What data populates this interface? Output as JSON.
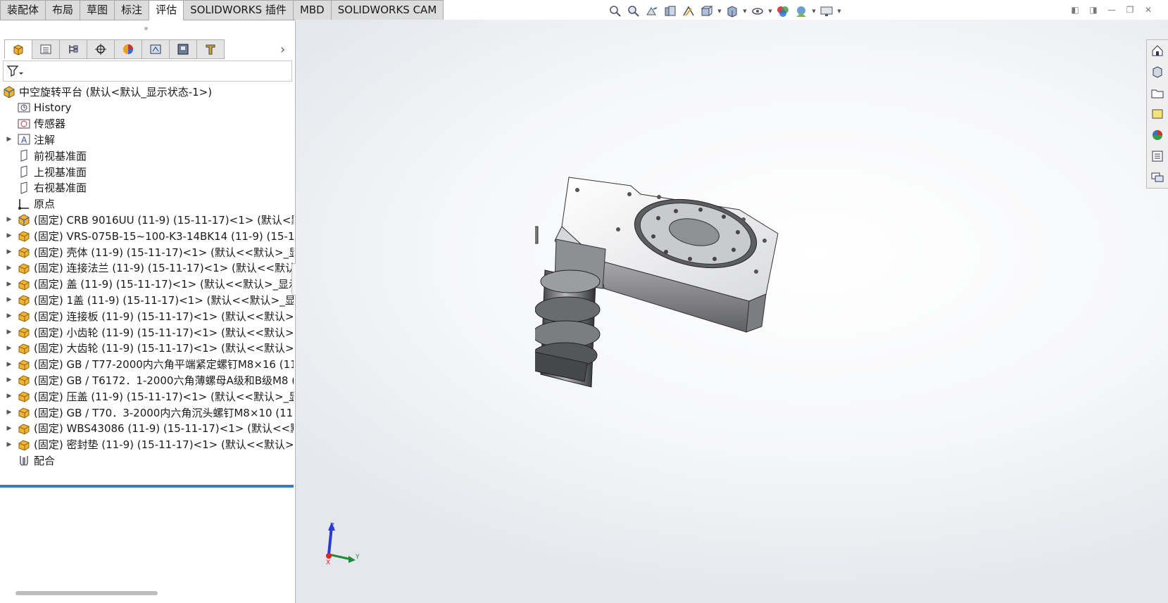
{
  "command_tabs": [
    {
      "label": "装配体"
    },
    {
      "label": "布局"
    },
    {
      "label": "草图"
    },
    {
      "label": "标注"
    },
    {
      "label": "评估",
      "active": true
    },
    {
      "label": "SOLIDWORKS 插件"
    },
    {
      "label": "MBD"
    },
    {
      "label": "SOLIDWORKS CAM"
    }
  ],
  "heads_up_toolbar": {
    "icons": [
      "zoom-to-fit-icon",
      "zoom-to-area-icon",
      "previous-view-icon",
      "section-view-icon",
      "dynamic-annotation-icon",
      "view-orientation-icon",
      "display-style-icon",
      "hide-show-items-icon",
      "edit-appearance-icon",
      "apply-scene-icon",
      "view-settings-icon"
    ]
  },
  "feature_tree": {
    "root": "中空旋转平台 (默认<默认_显示状态-1>)",
    "items": [
      {
        "label": "History",
        "icon": "history-folder-icon",
        "expandable": false
      },
      {
        "label": "传感器",
        "icon": "sensors-folder-icon",
        "expandable": false
      },
      {
        "label": "注解",
        "icon": "annotations-icon",
        "expandable": true
      },
      {
        "label": "前视基准面",
        "icon": "plane-icon",
        "expandable": false
      },
      {
        "label": "上视基准面",
        "icon": "plane-icon",
        "expandable": false
      },
      {
        "label": "右视基准面",
        "icon": "plane-icon",
        "expandable": false
      },
      {
        "label": "原点",
        "icon": "origin-icon",
        "expandable": false
      },
      {
        "label": "(固定) CRB 9016UU  (11-9)  (15-11-17)<1> (默认<默",
        "icon": "subassembly-icon",
        "expandable": true
      },
      {
        "label": "(固定) VRS-075B-15~100-K3-14BK14  (11-9)  (15-11",
        "icon": "part-icon",
        "expandable": true
      },
      {
        "label": "(固定) 壳体  (11-9)  (15-11-17)<1> (默认<<默认>_显",
        "icon": "part-icon",
        "expandable": true
      },
      {
        "label": "(固定) 连接法兰  (11-9)  (15-11-17)<1> (默认<<默认",
        "icon": "part-icon",
        "expandable": true
      },
      {
        "label": "(固定) 盖  (11-9)  (15-11-17)<1> (默认<<默认>_显示",
        "icon": "part-icon",
        "expandable": true
      },
      {
        "label": "(固定) 1盖  (11-9)  (15-11-17)<1> (默认<<默认>_显示",
        "icon": "part-icon",
        "expandable": true
      },
      {
        "label": "(固定) 连接板  (11-9)  (15-11-17)<1> (默认<<默认>_",
        "icon": "part-icon",
        "expandable": true
      },
      {
        "label": "(固定) 小齿轮  (11-9)  (15-11-17)<1> (默认<<默认>_",
        "icon": "part-icon",
        "expandable": true
      },
      {
        "label": "(固定) 大齿轮  (11-9)  (15-11-17)<1> (默认<<默认>_",
        "icon": "part-icon",
        "expandable": true
      },
      {
        "label": "(固定) GB / T77-2000内六角平端紧定螺钉M8×16  (11",
        "icon": "part-icon",
        "expandable": true
      },
      {
        "label": "(固定) GB / T6172．1-2000六角薄螺母A级和B级M8  (",
        "icon": "part-icon",
        "expandable": true
      },
      {
        "label": "(固定) 压盖  (11-9)  (15-11-17)<1> (默认<<默认>_显",
        "icon": "part-icon",
        "expandable": true
      },
      {
        "label": "(固定) GB / T70．3-2000内六角沉头螺钉M8×10  (11-",
        "icon": "part-icon",
        "expandable": true
      },
      {
        "label": "(固定) WBS43086  (11-9)  (15-11-17)<1> (默认<<默",
        "icon": "part-icon",
        "expandable": true
      },
      {
        "label": "(固定) 密封垫  (11-9)  (15-11-17)<1> (默认<<默认>_",
        "icon": "part-icon",
        "expandable": true
      },
      {
        "label": "配合",
        "icon": "mates-icon",
        "expandable": false
      }
    ]
  },
  "triad": {
    "x": "Y",
    "y": "Z",
    "z": "X"
  },
  "colors": {
    "accent": "#2f7fc1",
    "part_yellow": "#f2b233",
    "viewport_bg": "#eef0f3"
  }
}
